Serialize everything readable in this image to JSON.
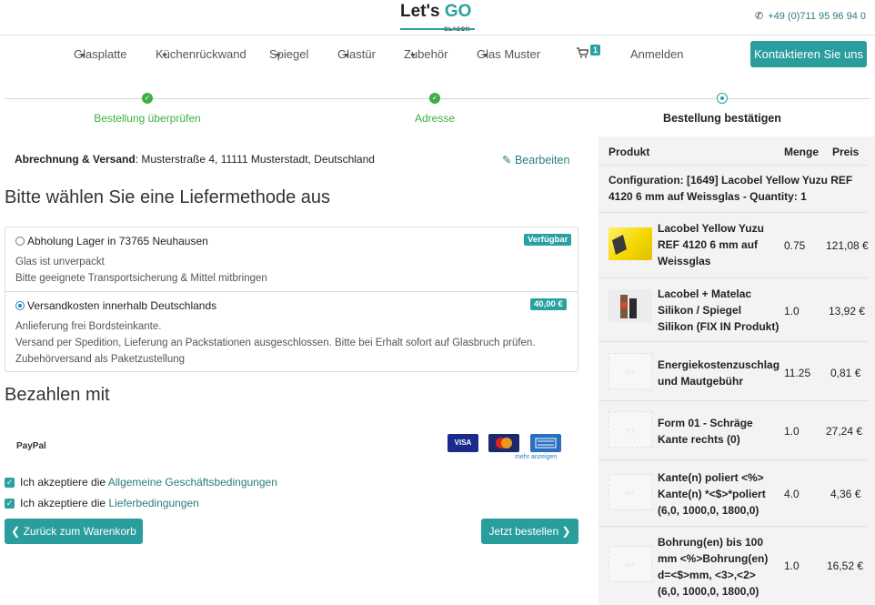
{
  "header": {
    "logo_main": "Let's",
    "logo_accent": "GO",
    "logo_sub": "GLASON",
    "phone_icon": "phone-icon",
    "phone": "+49 (0)711 95 96 94 0"
  },
  "nav": {
    "items": [
      "Glasplatte",
      "Küchenrückwand",
      "Spiegel",
      "Glastür",
      "Zubehör",
      "Glas Muster"
    ],
    "cart_icon": "cart-icon",
    "cart_count": "1",
    "login": "Anmelden",
    "contact": "Kontaktieren Sie uns"
  },
  "steps": [
    {
      "label": "Bestellung überprüfen",
      "done": true
    },
    {
      "label": "Adresse",
      "done": true
    },
    {
      "label": "Bestellung bestätigen",
      "done": false
    }
  ],
  "billing": {
    "label": "Abrechnung & Versand",
    "address": ": Musterstraße 4, 11111 Musterstadt, Deutschland",
    "edit": "Bearbeiten"
  },
  "delivery": {
    "heading": "Bitte wählen Sie eine Liefermethode aus",
    "options": [
      {
        "label": "Abholung Lager in 73765 Neuhausen",
        "badge": "Verfügbar",
        "selected": false,
        "lines": [
          "Glas ist unverpackt",
          "Bitte geeignete Transportsicherung & Mittel mitbringen"
        ]
      },
      {
        "label": "Versandkosten innerhalb Deutschlands",
        "badge": "40,00 €",
        "selected": true,
        "lines": [
          "Anlieferung frei Bordsteinkante.",
          "Versand per Spedition, Lieferung an Packstationen ausgeschlossen. Bitte bei Erhalt sofort auf Glasbruch prüfen.",
          "Zubehörversand als Paketzustellung"
        ]
      }
    ]
  },
  "payment": {
    "heading": "Bezahlen mit",
    "method": "PayPal",
    "cards": [
      "VISA",
      "MasterCard",
      "AMEX"
    ],
    "more": "mehr anzeigen"
  },
  "terms": [
    {
      "prefix": "Ich akzeptiere die ",
      "link": "Allgemeine Geschäftsbedingungen",
      "checked": true
    },
    {
      "prefix": "Ich akzeptiere die ",
      "link": "Lieferbedingungen",
      "checked": true
    }
  ],
  "buttons": {
    "back": "Zurück zum Warenkorb",
    "order": "Jetzt bestellen"
  },
  "summary": {
    "col_product": "Produkt",
    "col_qty": "Menge",
    "col_price": "Preis",
    "config": "Configuration: [1649] Lacobel Yellow Yuzu REF 4120 6 mm auf Weissglas - Quantity: 1",
    "rows": [
      {
        "lines": [
          "Lacobel Yellow Yuzu",
          "REF 4120 6 mm auf",
          "Weissglas"
        ],
        "qty": "0.75",
        "price": "121,08 €"
      },
      {
        "lines": [
          "Lacobel + Matelac",
          "Silikon / Spiegel",
          "Silikon (FIX IN Produkt)"
        ],
        "qty": "1.0",
        "price": "13,92 €"
      },
      {
        "lines": [
          "Energiekostenzuschlag",
          "und Mautgebühr"
        ],
        "qty": "11.25",
        "price": "0,81 €"
      },
      {
        "lines": [
          "Form 01 - Schräge",
          "Kante rechts (0)"
        ],
        "qty": "1.0",
        "price": "27,24 €"
      },
      {
        "lines": [
          "Kante(n) poliert <%>",
          "Kante(n) *<$>*poliert",
          "(6,0, 1000,0, 1800,0)"
        ],
        "qty": "4.0",
        "price": "4,36 €"
      },
      {
        "lines": [
          "Bohrung(en) bis 100",
          "mm <%>Bohrung(en)",
          "d=<$>mm, <3>,<2>",
          "(6,0, 1000,0, 1800,0)"
        ],
        "qty": "1.0",
        "price": "16,52 €"
      }
    ]
  },
  "colors": {
    "accent": "#2a9d9d",
    "done": "#3cb043",
    "link": "#2a7d80"
  }
}
